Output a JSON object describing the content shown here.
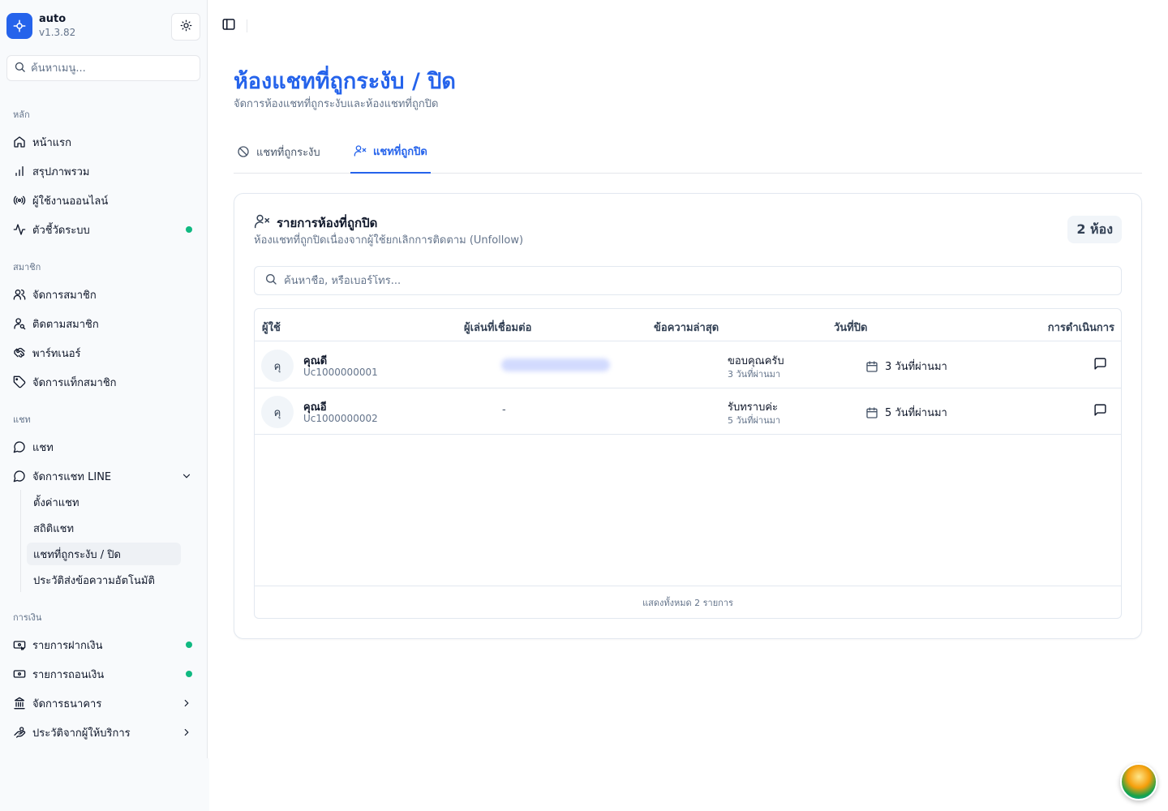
{
  "app": {
    "name": "auto",
    "version": "v1.3.82"
  },
  "sidebar": {
    "search_placeholder": "ค้นหาเมนู...",
    "sections": {
      "main": "หลัก",
      "members": "สมาชิก",
      "chat": "แชท",
      "finance": "การเงิน"
    },
    "items": {
      "home": "หน้าแรก",
      "overview": "สรุปภาพรวม",
      "online_users": "ผู้ใช้งานออนไลน์",
      "metrics": "ตัวชี้วัดระบบ",
      "manage_members": "จัดการสมาชิก",
      "follow_members": "ติดตามสมาชิก",
      "partners": "พาร์ทเนอร์",
      "member_tags": "จัดการแท็กสมาชิก",
      "chat": "แชท",
      "line_chat": "จัดการแชท LINE",
      "deposits": "รายการฝากเงิน",
      "withdrawals": "รายการถอนเงิน",
      "banks": "จัดการธนาคาร",
      "provider_history": "ประวัติจากผู้ให้บริการ"
    },
    "line_sub": {
      "settings": "ตั้งค่าแชท",
      "stats": "สถิติแชท",
      "suspended_closed": "แชทที่ถูกระงับ / ปิด",
      "auto_history": "ประวัติส่งข้อความอัตโนมัติ"
    },
    "status_color": "#10b981"
  },
  "page": {
    "title": "ห้องแชทที่ถูกระงับ / ปิด",
    "subtitle": "จัดการห้องแชทที่ถูกระงับและห้องแชทที่ถูกปิด",
    "accent": "#2563eb"
  },
  "tabs": {
    "suspended": "แชทที่ถูกระงับ",
    "closed": "แชทที่ถูกปิด"
  },
  "card": {
    "title": "รายการห้องที่ถูกปิด",
    "subtitle": "ห้องแชทที่ถูกปิดเนื่องจากผู้ใช้ยกเลิกการติดตาม (Unfollow)",
    "count_badge": "2 ห้อง",
    "search_placeholder": "ค้นหาชื่อ, หรือเบอร์โทร..."
  },
  "table": {
    "headers": {
      "user": "ผู้ใช้",
      "player": "ผู้เล่นที่เชื่อมต่อ",
      "last_message": "ข้อความล่าสุด",
      "closed_date": "วันที่ปิด",
      "actions": "การดำเนินการ"
    },
    "rows": [
      {
        "avatar": "คุ",
        "name": "คุณดี",
        "id": "Uc1000000001",
        "player": "",
        "message": "ขอบคุณครับ",
        "message_time": "3 วันที่ผ่านมา",
        "closed": "3 วันที่ผ่านมา"
      },
      {
        "avatar": "คุ",
        "name": "คุณอี",
        "id": "Uc1000000002",
        "player": "-",
        "message": "รับทราบค่ะ",
        "message_time": "5 วันที่ผ่านมา",
        "closed": "5 วันที่ผ่านมา"
      }
    ],
    "footer": "แสดงทั้งหมด 2 รายการ"
  }
}
